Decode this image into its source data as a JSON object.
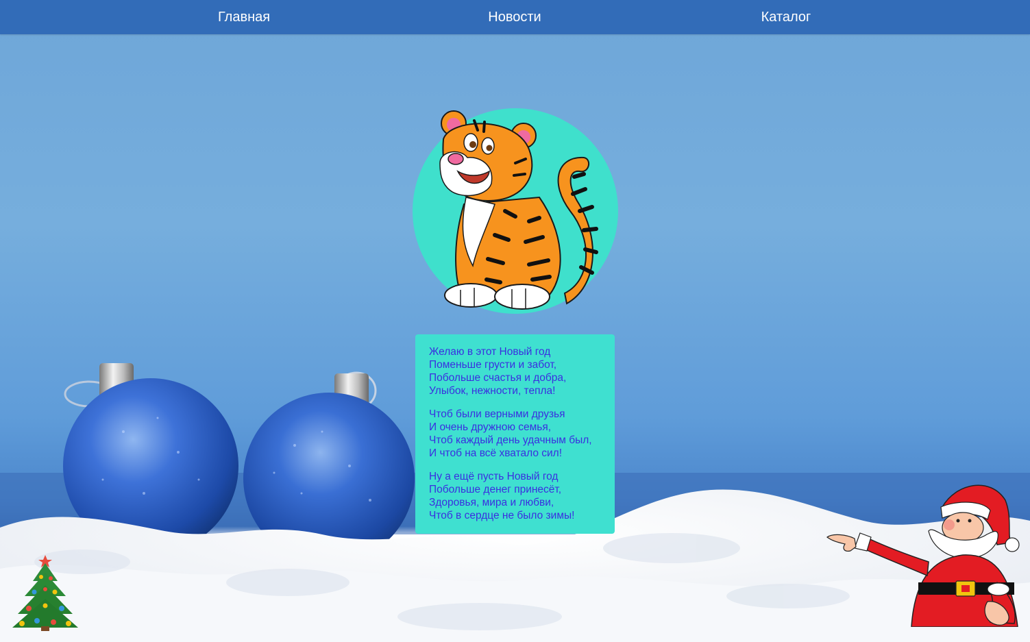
{
  "nav": {
    "items": [
      {
        "label": "Главная"
      },
      {
        "label": "Новости"
      },
      {
        "label": "Каталог"
      }
    ]
  },
  "colors": {
    "nav_bg": "#326cb8",
    "nav_text": "#ffffff",
    "circle_bg": "#3fe0cc",
    "poem_bg": "#3fe0d0",
    "poem_text": "#3a2fe0"
  },
  "images": {
    "hero": "tiger-illustration",
    "decor_left": "christmas-tree-illustration",
    "decor_right": "santa-claus-illustration",
    "background": "blue-christmas-baubles-on-snow"
  },
  "poem": {
    "stanzas": [
      {
        "lines": [
          "Желаю в этот Новый год",
          "Поменьше грусти и забот,",
          "Побольше счастья и добра,",
          "Улыбок, нежности, тепла!"
        ]
      },
      {
        "lines": [
          "Чтоб были верными друзья",
          "И очень дружною семья,",
          "Чтоб каждый день удачным был,",
          "И чтоб на всё хватало сил!"
        ]
      },
      {
        "lines": [
          "Ну а ещё пусть Новый год",
          "Побольше денег принесёт,",
          "Здоровья, мира и любви,",
          "Чтоб в сердце не было зимы!"
        ]
      }
    ]
  }
}
